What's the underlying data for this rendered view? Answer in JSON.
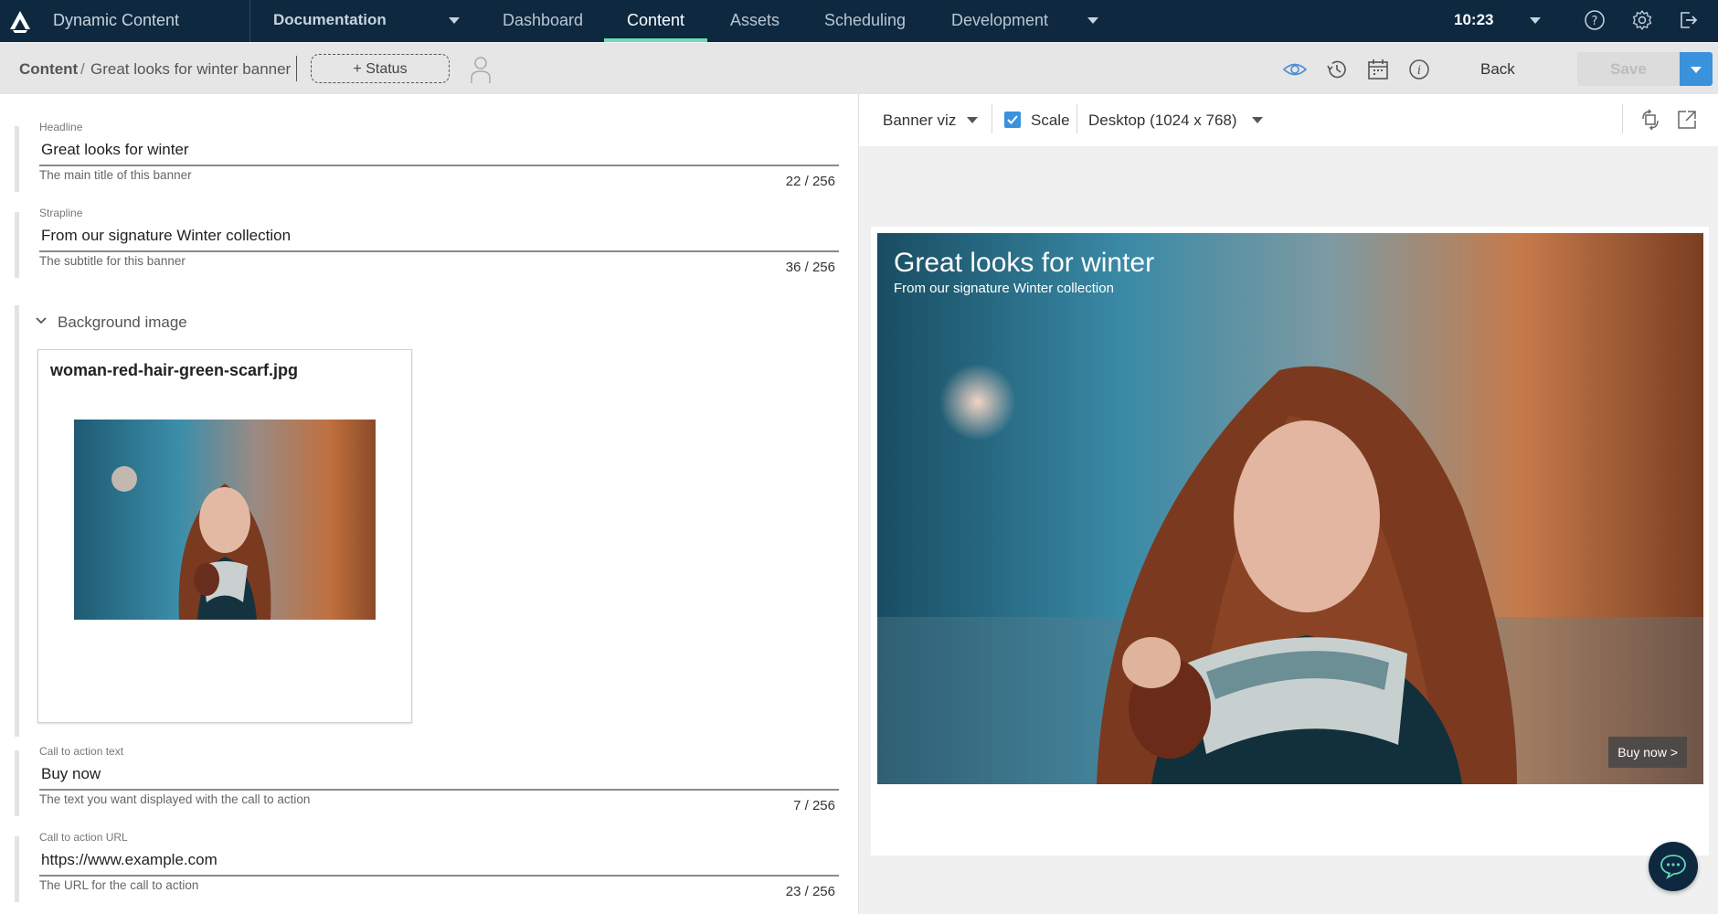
{
  "nav": {
    "app_name": "Dynamic Content",
    "hub": "Documentation",
    "tabs": [
      {
        "label": "Dashboard",
        "active": false
      },
      {
        "label": "Content",
        "active": true
      },
      {
        "label": "Assets",
        "active": false
      },
      {
        "label": "Scheduling",
        "active": false
      },
      {
        "label": "Development",
        "active": false
      }
    ],
    "time": "10:23",
    "icons": [
      "logo-icon",
      "help-icon",
      "settings-icon",
      "logout-icon"
    ],
    "accent": "#6fdcb8",
    "background": "#0e2840"
  },
  "toolbar": {
    "breadcrumb_root": "Content",
    "breadcrumb_sep": "/",
    "breadcrumb_leaf": "Great looks for winter banner",
    "status_button": "+ Status",
    "back_label": "Back",
    "save_label": "Save",
    "icons": [
      "assignee-icon",
      "preview-eye-icon",
      "history-icon",
      "calendar-icon",
      "info-icon"
    ],
    "save_accent": "#3a92dd"
  },
  "form": {
    "headline": {
      "label": "Headline",
      "value": "Great looks for winter",
      "help": "The main title of this banner",
      "count": "22 / 256"
    },
    "strapline": {
      "label": "Strapline",
      "value": "From our signature Winter collection",
      "help": "The subtitle for this banner",
      "count": "36 / 256"
    },
    "background_image": {
      "section_title": "Background image",
      "file_name": "woman-red-hair-green-scarf.jpg"
    },
    "cta_text": {
      "label": "Call to action text",
      "value": "Buy now",
      "help": "The text you want displayed with the call to action",
      "count": "7 / 256"
    },
    "cta_url": {
      "label": "Call to action URL",
      "value": "https://www.example.com",
      "help": "The URL for the call to action",
      "count": "23 / 256"
    }
  },
  "preview": {
    "visualization": "Banner viz",
    "scale_label": "Scale",
    "scale_checked": true,
    "device": "Desktop (1024 x 768)",
    "banner_title": "Great looks for winter",
    "banner_subtitle": "From our signature Winter collection",
    "banner_cta": "Buy now >"
  }
}
